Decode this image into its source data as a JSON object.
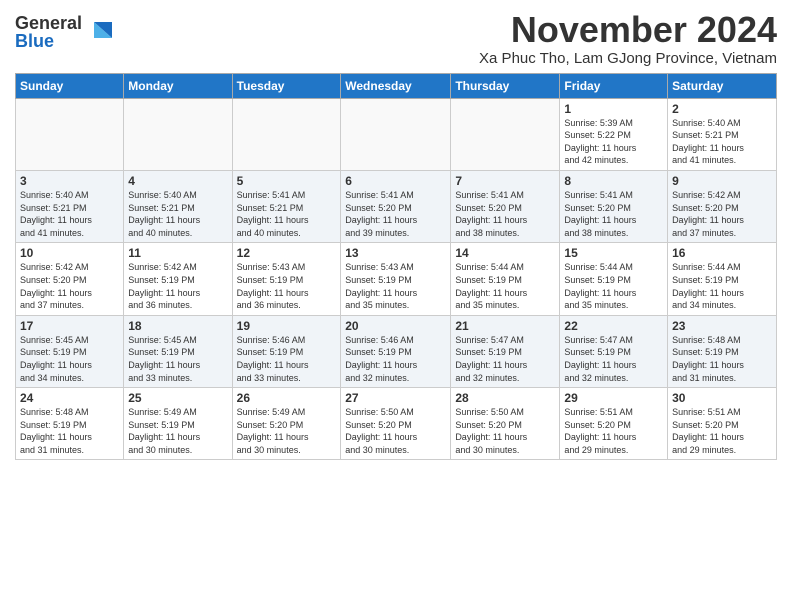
{
  "logo": {
    "general": "General",
    "blue": "Blue"
  },
  "header": {
    "title": "November 2024",
    "subtitle": "Xa Phuc Tho, Lam GJong Province, Vietnam"
  },
  "columns": [
    "Sunday",
    "Monday",
    "Tuesday",
    "Wednesday",
    "Thursday",
    "Friday",
    "Saturday"
  ],
  "weeks": [
    [
      {
        "day": "",
        "info": ""
      },
      {
        "day": "",
        "info": ""
      },
      {
        "day": "",
        "info": ""
      },
      {
        "day": "",
        "info": ""
      },
      {
        "day": "",
        "info": ""
      },
      {
        "day": "1",
        "info": "Sunrise: 5:39 AM\nSunset: 5:22 PM\nDaylight: 11 hours\nand 42 minutes."
      },
      {
        "day": "2",
        "info": "Sunrise: 5:40 AM\nSunset: 5:21 PM\nDaylight: 11 hours\nand 41 minutes."
      }
    ],
    [
      {
        "day": "3",
        "info": "Sunrise: 5:40 AM\nSunset: 5:21 PM\nDaylight: 11 hours\nand 41 minutes."
      },
      {
        "day": "4",
        "info": "Sunrise: 5:40 AM\nSunset: 5:21 PM\nDaylight: 11 hours\nand 40 minutes."
      },
      {
        "day": "5",
        "info": "Sunrise: 5:41 AM\nSunset: 5:21 PM\nDaylight: 11 hours\nand 40 minutes."
      },
      {
        "day": "6",
        "info": "Sunrise: 5:41 AM\nSunset: 5:20 PM\nDaylight: 11 hours\nand 39 minutes."
      },
      {
        "day": "7",
        "info": "Sunrise: 5:41 AM\nSunset: 5:20 PM\nDaylight: 11 hours\nand 38 minutes."
      },
      {
        "day": "8",
        "info": "Sunrise: 5:41 AM\nSunset: 5:20 PM\nDaylight: 11 hours\nand 38 minutes."
      },
      {
        "day": "9",
        "info": "Sunrise: 5:42 AM\nSunset: 5:20 PM\nDaylight: 11 hours\nand 37 minutes."
      }
    ],
    [
      {
        "day": "10",
        "info": "Sunrise: 5:42 AM\nSunset: 5:20 PM\nDaylight: 11 hours\nand 37 minutes."
      },
      {
        "day": "11",
        "info": "Sunrise: 5:42 AM\nSunset: 5:19 PM\nDaylight: 11 hours\nand 36 minutes."
      },
      {
        "day": "12",
        "info": "Sunrise: 5:43 AM\nSunset: 5:19 PM\nDaylight: 11 hours\nand 36 minutes."
      },
      {
        "day": "13",
        "info": "Sunrise: 5:43 AM\nSunset: 5:19 PM\nDaylight: 11 hours\nand 35 minutes."
      },
      {
        "day": "14",
        "info": "Sunrise: 5:44 AM\nSunset: 5:19 PM\nDaylight: 11 hours\nand 35 minutes."
      },
      {
        "day": "15",
        "info": "Sunrise: 5:44 AM\nSunset: 5:19 PM\nDaylight: 11 hours\nand 35 minutes."
      },
      {
        "day": "16",
        "info": "Sunrise: 5:44 AM\nSunset: 5:19 PM\nDaylight: 11 hours\nand 34 minutes."
      }
    ],
    [
      {
        "day": "17",
        "info": "Sunrise: 5:45 AM\nSunset: 5:19 PM\nDaylight: 11 hours\nand 34 minutes."
      },
      {
        "day": "18",
        "info": "Sunrise: 5:45 AM\nSunset: 5:19 PM\nDaylight: 11 hours\nand 33 minutes."
      },
      {
        "day": "19",
        "info": "Sunrise: 5:46 AM\nSunset: 5:19 PM\nDaylight: 11 hours\nand 33 minutes."
      },
      {
        "day": "20",
        "info": "Sunrise: 5:46 AM\nSunset: 5:19 PM\nDaylight: 11 hours\nand 32 minutes."
      },
      {
        "day": "21",
        "info": "Sunrise: 5:47 AM\nSunset: 5:19 PM\nDaylight: 11 hours\nand 32 minutes."
      },
      {
        "day": "22",
        "info": "Sunrise: 5:47 AM\nSunset: 5:19 PM\nDaylight: 11 hours\nand 32 minutes."
      },
      {
        "day": "23",
        "info": "Sunrise: 5:48 AM\nSunset: 5:19 PM\nDaylight: 11 hours\nand 31 minutes."
      }
    ],
    [
      {
        "day": "24",
        "info": "Sunrise: 5:48 AM\nSunset: 5:19 PM\nDaylight: 11 hours\nand 31 minutes."
      },
      {
        "day": "25",
        "info": "Sunrise: 5:49 AM\nSunset: 5:19 PM\nDaylight: 11 hours\nand 30 minutes."
      },
      {
        "day": "26",
        "info": "Sunrise: 5:49 AM\nSunset: 5:20 PM\nDaylight: 11 hours\nand 30 minutes."
      },
      {
        "day": "27",
        "info": "Sunrise: 5:50 AM\nSunset: 5:20 PM\nDaylight: 11 hours\nand 30 minutes."
      },
      {
        "day": "28",
        "info": "Sunrise: 5:50 AM\nSunset: 5:20 PM\nDaylight: 11 hours\nand 30 minutes."
      },
      {
        "day": "29",
        "info": "Sunrise: 5:51 AM\nSunset: 5:20 PM\nDaylight: 11 hours\nand 29 minutes."
      },
      {
        "day": "30",
        "info": "Sunrise: 5:51 AM\nSunset: 5:20 PM\nDaylight: 11 hours\nand 29 minutes."
      }
    ]
  ]
}
